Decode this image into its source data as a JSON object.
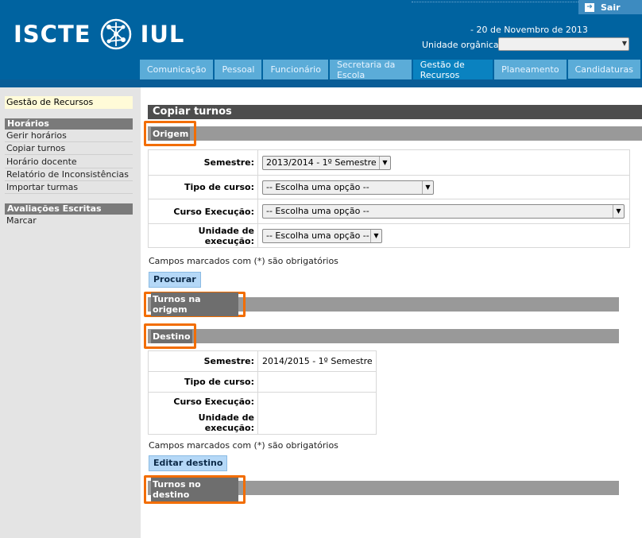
{
  "header": {
    "logo_left": "ISCTE",
    "logo_right": "IUL",
    "logout_label": "Sair",
    "date": "- 20 de Novembro de 2013",
    "unit_label": "Unidade orgânica:",
    "unit_value": "",
    "tabs": [
      {
        "label": "Comunicação"
      },
      {
        "label": "Pessoal"
      },
      {
        "label": "Funcionário"
      },
      {
        "label": "Secretaria da Escola"
      },
      {
        "label": "Gestão de Recursos"
      },
      {
        "label": "Planeamento"
      },
      {
        "label": "Candidaturas"
      }
    ]
  },
  "sidebar": {
    "top_item": "Gestão de Recursos",
    "groups": [
      {
        "title": "Horários",
        "items": [
          "Gerir horários",
          "Copiar turnos",
          "Horário docente",
          "Relatório de Inconsistências",
          "Importar turmas"
        ]
      },
      {
        "title": "Avaliações Escritas",
        "items": [
          "Marcar"
        ]
      }
    ]
  },
  "main": {
    "title": "Copiar turnos",
    "origem": {
      "section": "Origem",
      "semestre_label": "Semestre:",
      "semestre_value": "2013/2014 - 1º Semestre",
      "tipo_label": "Tipo de curso:",
      "tipo_value": "-- Escolha uma opção --",
      "curso_label": "Curso Execução:",
      "curso_value": "-- Escolha uma opção --",
      "unidade_label": "Unidade de execução:",
      "unidade_value": "-- Escolha uma opção --",
      "note": "Campos marcados com (*) são obrigatórios",
      "button": "Procurar"
    },
    "turnos_origem": "Turnos na origem",
    "destino": {
      "section": "Destino",
      "semestre_label": "Semestre:",
      "semestre_value": "2014/2015 - 1º Semestre",
      "tipo_label": "Tipo de curso:",
      "curso_label": "Curso Execução:",
      "unidade_label": "Unidade de execução:",
      "note": "Campos marcados com (*) são obrigatórios",
      "button": "Editar destino"
    },
    "turnos_destino": "Turnos no destino"
  },
  "colors": {
    "header_blue": "#0063a0",
    "tab_active": "#0a82c0",
    "highlight_orange": "#f26d00"
  }
}
